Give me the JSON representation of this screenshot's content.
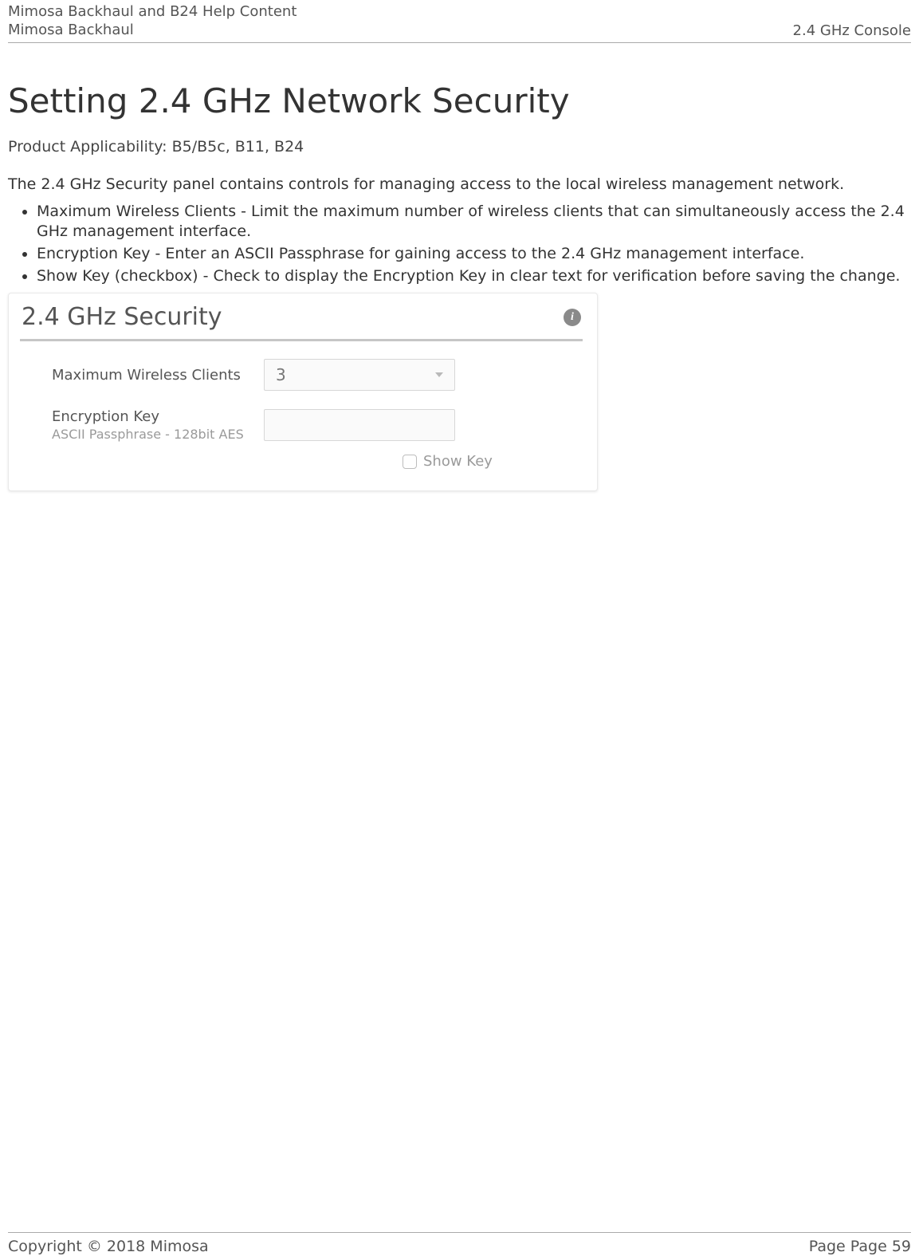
{
  "header": {
    "line1": "Mimosa Backhaul and B24 Help Content",
    "line2": "Mimosa Backhaul",
    "right": "2.4 GHz Console"
  },
  "main": {
    "title": "Setting 2.4 GHz Network Security",
    "applicability": "Product Applicability: B5/B5c, B11, B24",
    "intro": "The 2.4 GHz Security panel contains controls for managing access to the local wireless management network.",
    "bullets": [
      "Maximum Wireless Clients - Limit the maximum number of wireless clients that can simultaneously access the 2.4 GHz management interface.",
      "Encryption Key - Enter an ASCII Passphrase for gaining access to the 2.4 GHz management interface.",
      "Show Key (checkbox) - Check to display the Encryption Key in clear text for verification before saving the change."
    ]
  },
  "panel": {
    "title": "2.4 GHz Security",
    "info_tooltip": "i",
    "fields": {
      "max_clients": {
        "label": "Maximum Wireless Clients",
        "value": "3"
      },
      "encryption_key": {
        "label": "Encryption Key",
        "sublabel": "ASCII Passphrase - 128bit AES",
        "value": ""
      },
      "show_key": {
        "label": "Show Key",
        "checked": false
      }
    }
  },
  "footer": {
    "copyright": "Copyright © 2018 Mimosa",
    "page": "Page Page 59"
  }
}
